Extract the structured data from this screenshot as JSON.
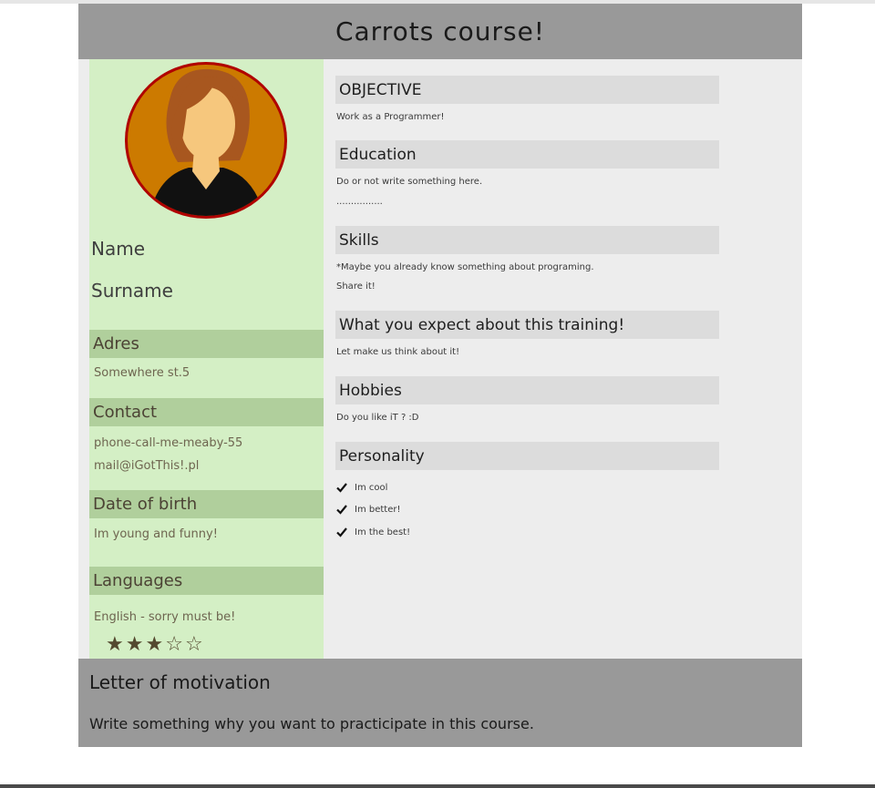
{
  "header": {
    "title": "Carrots course!"
  },
  "profile": {
    "name": "Name",
    "surname": "Surname"
  },
  "sidebar": {
    "address": {
      "heading": "Adres",
      "value": "Somewhere st.5"
    },
    "contact": {
      "heading": "Contact",
      "phone": "phone-call-me-meaby-55",
      "email": "mail@iGotThis!.pl"
    },
    "birth": {
      "heading": "Date of birth",
      "value": "Im young and funny!"
    },
    "languages": {
      "heading": "Languages",
      "value": "English - sorry must be!",
      "rating": 3,
      "rating_max": 5
    }
  },
  "main": {
    "objective": {
      "heading": "OBJECTIVE",
      "text": "Work as a Programmer!"
    },
    "education": {
      "heading": "Education",
      "text": "Do or not write something here.",
      "text2": "................"
    },
    "skills": {
      "heading": "Skills",
      "text": "*Maybe you already know something about programing.",
      "text2": "Share it!"
    },
    "expect": {
      "heading": "What you expect about this training!",
      "text": "Let make us think about it!"
    },
    "hobbies": {
      "heading": "Hobbies",
      "text": "Do you like iT ? :D"
    },
    "personality": {
      "heading": "Personality",
      "items": [
        "Im cool",
        "Im better!",
        "Im the best!"
      ]
    }
  },
  "footer": {
    "title": "Letter of motivation",
    "text": "Write something why you want to practicipate in this course."
  },
  "icons": {
    "check": "check-icon",
    "star": "star-icon",
    "avatar": "avatar-icon"
  },
  "colors": {
    "header_bg": "#999999",
    "sidebar_bg": "#d4efc5",
    "sidebar_heading_bg": "#b0cf9c",
    "main_heading_bg": "#dcdcdc",
    "avatar_ring": "#b00000",
    "avatar_fill": "#cc7a00"
  }
}
